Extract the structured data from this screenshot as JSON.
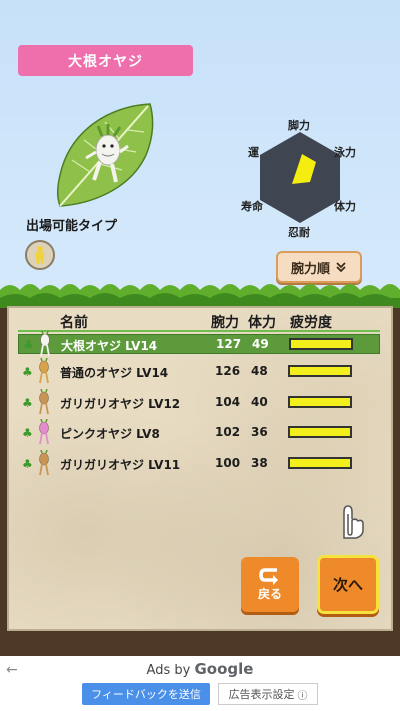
{
  "character": {
    "name": "大根オヤジ"
  },
  "available_type": {
    "label": "出場可能タイプ"
  },
  "radar": {
    "labels": {
      "top": "脚力",
      "upper_right": "泳力",
      "lower_right": "体力",
      "bottom": "忍耐",
      "lower_left": "寿命",
      "upper_left": "運"
    },
    "fill_color": "#f5ec10",
    "frame_color": "#3f4652"
  },
  "sort_button": {
    "label": "腕力順",
    "icon": "double-chevron-down-icon"
  },
  "table": {
    "headers": {
      "name": "名前",
      "power": "腕力",
      "stamina": "体力",
      "fatigue": "疲労度"
    },
    "rows": [
      {
        "name": "大根オヤジ LV14",
        "power": "127",
        "stamina": "49",
        "fatigue": 1.0,
        "selected": true
      },
      {
        "name": "普通のオヤジ LV14",
        "power": "126",
        "stamina": "48",
        "fatigue": 1.0,
        "selected": false
      },
      {
        "name": "ガリガリオヤジ LV12",
        "power": "104",
        "stamina": "40",
        "fatigue": 1.0,
        "selected": false
      },
      {
        "name": "ピンクオヤジ LV8",
        "power": "102",
        "stamina": "36",
        "fatigue": 1.0,
        "selected": false
      },
      {
        "name": "ガリガリオヤジ LV11",
        "power": "100",
        "stamina": "38",
        "fatigue": 1.0,
        "selected": false
      }
    ]
  },
  "buttons": {
    "back": "戻る",
    "next": "次へ"
  },
  "ad": {
    "prefix": "Ads by",
    "brand": "Google",
    "feedback": "フィードバックを送信",
    "settings": "広告表示設定"
  },
  "colors": {
    "accent_pink": "#ef6fad",
    "button_orange": "#ef8a2b",
    "selected_row": "#5c9a3c",
    "fatigue_fill": "#f3ef1c"
  }
}
